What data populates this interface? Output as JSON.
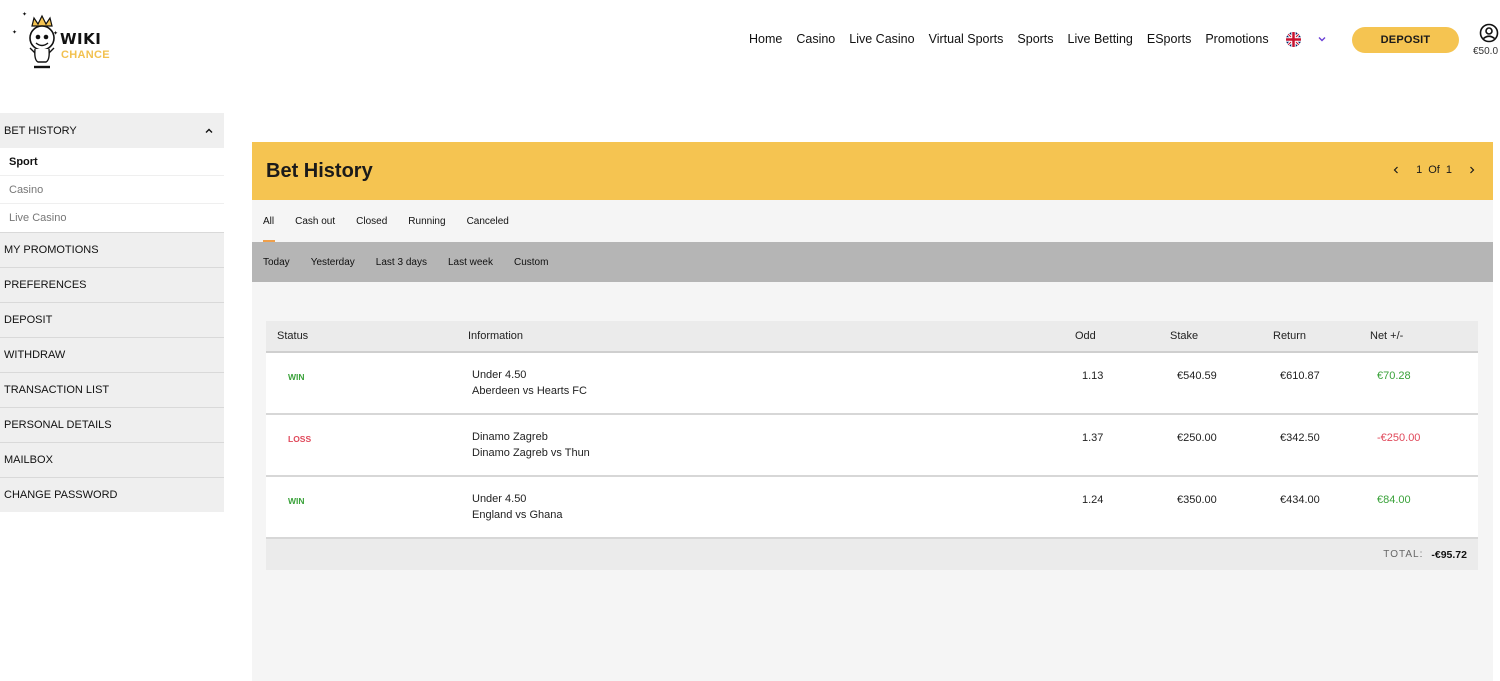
{
  "brand": {
    "name": "WIKI",
    "sub": "CHANCE"
  },
  "nav": [
    "Home",
    "Casino",
    "Live Casino",
    "Virtual Sports",
    "Sports",
    "Live Betting",
    "ESports",
    "Promotions"
  ],
  "header": {
    "deposit_label": "DEPOSIT",
    "balance": "€50.0"
  },
  "sidebar": {
    "section_title": "BET HISTORY",
    "sub_items": [
      {
        "label": "Sport",
        "active": true
      },
      {
        "label": "Casino",
        "active": false
      },
      {
        "label": "Live Casino",
        "active": false
      }
    ],
    "items": [
      "MY PROMOTIONS",
      "PREFERENCES",
      "DEPOSIT",
      "WITHDRAW",
      "TRANSACTION LIST",
      "PERSONAL DETAILS",
      "MAILBOX",
      "CHANGE PASSWORD"
    ]
  },
  "main": {
    "title": "Bet History",
    "pager": {
      "current": "1",
      "of_label": "Of",
      "total": "1"
    },
    "tabs": [
      "All",
      "Cash out",
      "Closed",
      "Running",
      "Canceled"
    ],
    "filters": [
      "Today",
      "Yesterday",
      "Last 3 days",
      "Last week",
      "Custom"
    ],
    "table": {
      "columns": [
        "Status",
        "Information",
        "Odd",
        "Stake",
        "Return",
        "Net +/-"
      ],
      "rows": [
        {
          "status": "WIN",
          "line1": "Under 4.50",
          "line2": "Aberdeen vs Hearts FC",
          "odd": "1.13",
          "stake": "€540.59",
          "return": "€610.87",
          "net": "€70.28"
        },
        {
          "status": "LOSS",
          "line1": "Dinamo Zagreb",
          "line2": "Dinamo Zagreb vs Thun",
          "odd": "1.37",
          "stake": "€250.00",
          "return": "€342.50",
          "net": "-€250.00"
        },
        {
          "status": "WIN",
          "line1": "Under 4.50",
          "line2": "England vs Ghana",
          "odd": "1.24",
          "stake": "€350.00",
          "return": "€434.00",
          "net": "€84.00"
        }
      ],
      "total_label": "TOTAL:",
      "total_value": "-€95.72"
    }
  },
  "colors": {
    "accent": "#f5c451",
    "win": "#3aa23a",
    "loss": "#e0485a",
    "tab_indicator": "#f0a04b"
  }
}
